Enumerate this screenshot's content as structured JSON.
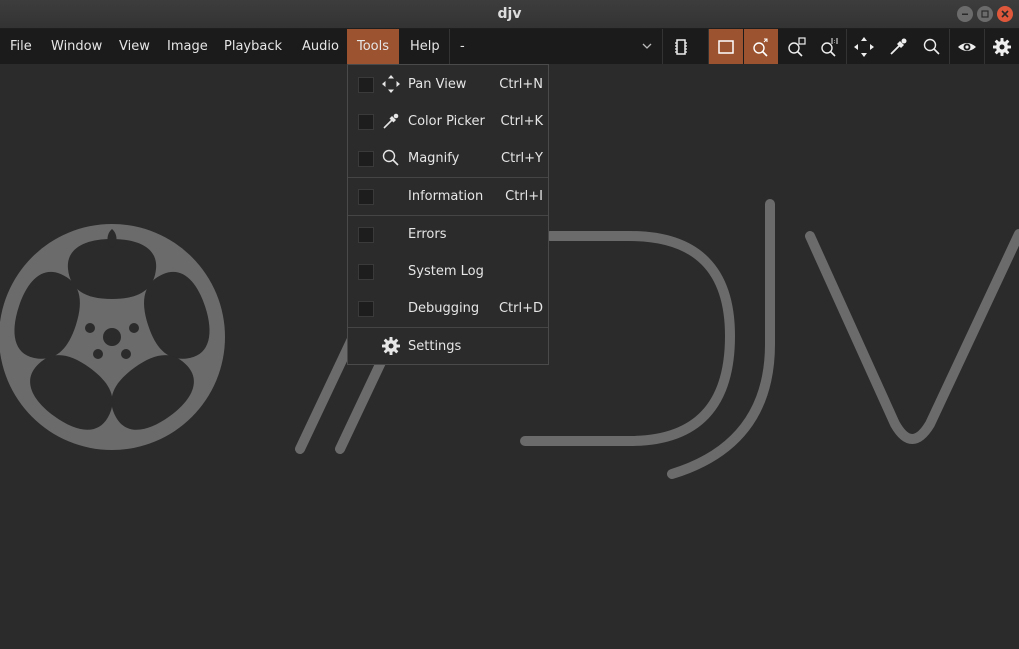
{
  "window": {
    "title": "djv"
  },
  "menubar": {
    "items": [
      "File",
      "Window",
      "View",
      "Image",
      "Playback",
      "Audio",
      "Tools",
      "Help"
    ],
    "file_combo": "-"
  },
  "toolbar": {
    "icons": [
      "memory-cache-icon",
      "fit-frame-icon",
      "zoom-fit-icon",
      "zoom-fill-icon",
      "zoom-one-to-one-icon",
      "pan-view-icon",
      "color-picker-icon",
      "magnify-icon",
      "eye-icon",
      "settings-gear-icon"
    ],
    "active": [
      "fit-frame-icon",
      "zoom-fit-icon"
    ],
    "accent_color": "#9c5330"
  },
  "tools_menu": {
    "items": [
      {
        "label": "Pan View",
        "shortcut": "Ctrl+N",
        "icon": "pan-view-icon"
      },
      {
        "label": "Color Picker",
        "shortcut": "Ctrl+K",
        "icon": "color-picker-icon"
      },
      {
        "label": "Magnify",
        "shortcut": "Ctrl+Y",
        "icon": "magnify-icon"
      },
      {
        "label": "Information",
        "shortcut": "Ctrl+I",
        "icon": ""
      },
      {
        "label": "Errors",
        "shortcut": "",
        "icon": ""
      },
      {
        "label": "System Log",
        "shortcut": "",
        "icon": ""
      },
      {
        "label": "Debugging",
        "shortcut": "Ctrl+D",
        "icon": ""
      },
      {
        "label": "Settings",
        "shortcut": "",
        "icon": "gear-icon"
      }
    ]
  }
}
